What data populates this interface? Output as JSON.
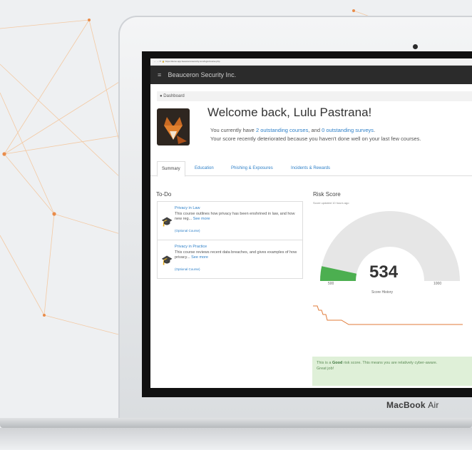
{
  "browser": {
    "url": "https://demo.app.beauceronsecurity.com/login/course.php"
  },
  "topnav": {
    "app_name": "Beauceron Security Inc."
  },
  "breadcrumb": {
    "label": "Dashboard"
  },
  "header": {
    "welcome": "Welcome back, Lulu Pastrana!",
    "line1_pre": "You currently have ",
    "line1_link1": "2 outstanding courses",
    "line1_mid": ", and ",
    "line1_link2": "0 outstanding surveys",
    "line1_post": ".",
    "line2": "Your score recently deteriorated because you haven't done well on your last few courses."
  },
  "tabs": [
    "Summary",
    "Education",
    "Phishing & Exposures",
    "Incidents & Rewards"
  ],
  "todo": {
    "title": "To-Do",
    "items": [
      {
        "title": "Privacy in Law",
        "desc": "This course outlines how privacy has been enshrined in law, and how new reg...",
        "more": "See more",
        "tag": "(Optional Course)"
      },
      {
        "title": "Privacy in Practice",
        "desc": "This course reviews recent data breaches, and gives examples of how privacy...",
        "more": "See more",
        "tag": "(Optional Course)"
      }
    ]
  },
  "risk": {
    "title": "Risk Score",
    "updated": "Score updated 10 hours ago",
    "score": "534",
    "min": "500",
    "max": "1000",
    "score_value": 534,
    "min_value": 500,
    "max_value": 1000,
    "history_label": "Score History",
    "message_pre": "This is a ",
    "message_bold": "Good",
    "message_post": " risk score. This means you are relatively cyber-aware.",
    "message_line2": "Great job!"
  },
  "device": {
    "brand": "MacBook",
    "model": "Air"
  },
  "colors": {
    "accent": "#2f80c8",
    "gauge_fill": "#4caf50",
    "history_line": "#e07b39",
    "alert_bg": "#dff0d8"
  }
}
